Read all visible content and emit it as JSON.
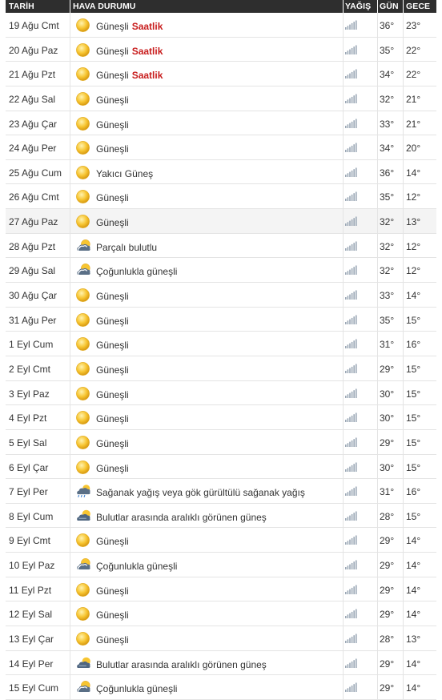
{
  "header": {
    "date": "TARİH",
    "weather": "HAVA DURUMU",
    "rain": "YAĞIŞ",
    "day": "GÜN",
    "night": "GECE"
  },
  "hourly_label": "Saatlik",
  "rows": [
    {
      "date": "19 Ağu Cmt",
      "condition": "Güneşli",
      "icon": "sun-icon",
      "hourly": true,
      "day": "36°",
      "night": "23°"
    },
    {
      "date": "20 Ağu Paz",
      "condition": "Güneşli",
      "icon": "sun-icon",
      "hourly": true,
      "day": "35°",
      "night": "22°"
    },
    {
      "date": "21 Ağu Pzt",
      "condition": "Güneşli",
      "icon": "sun-icon",
      "hourly": true,
      "day": "34°",
      "night": "22°"
    },
    {
      "date": "22 Ağu Sal",
      "condition": "Güneşli",
      "icon": "sun-icon",
      "day": "32°",
      "night": "21°"
    },
    {
      "date": "23 Ağu Çar",
      "condition": "Güneşli",
      "icon": "sun-icon",
      "day": "33°",
      "night": "21°"
    },
    {
      "date": "24 Ağu Per",
      "condition": "Güneşli",
      "icon": "sun-icon",
      "day": "34°",
      "night": "20°"
    },
    {
      "date": "25 Ağu Cum",
      "condition": "Yakıcı Güneş",
      "icon": "sun-icon",
      "day": "36°",
      "night": "14°"
    },
    {
      "date": "26 Ağu Cmt",
      "condition": "Güneşli",
      "icon": "sun-icon",
      "day": "35°",
      "night": "12°"
    },
    {
      "date": "27 Ağu Paz",
      "condition": "Güneşli",
      "icon": "sun-icon",
      "day": "32°",
      "night": "13°",
      "highlight": true
    },
    {
      "date": "28 Ağu Pzt",
      "condition": "Parçalı bulutlu",
      "icon": "partly-cloudy-icon",
      "day": "32°",
      "night": "12°"
    },
    {
      "date": "29 Ağu Sal",
      "condition": "Çoğunlukla güneşli",
      "icon": "partly-cloudy-icon",
      "day": "32°",
      "night": "12°"
    },
    {
      "date": "30 Ağu Çar",
      "condition": "Güneşli",
      "icon": "sun-icon",
      "day": "33°",
      "night": "14°"
    },
    {
      "date": "31 Ağu Per",
      "condition": "Güneşli",
      "icon": "sun-icon",
      "day": "35°",
      "night": "15°"
    },
    {
      "date": "1 Eyl Cum",
      "condition": "Güneşli",
      "icon": "sun-icon",
      "day": "31°",
      "night": "16°"
    },
    {
      "date": "2 Eyl Cmt",
      "condition": "Güneşli",
      "icon": "sun-icon",
      "day": "29°",
      "night": "15°"
    },
    {
      "date": "3 Eyl Paz",
      "condition": "Güneşli",
      "icon": "sun-icon",
      "day": "30°",
      "night": "15°"
    },
    {
      "date": "4 Eyl Pzt",
      "condition": "Güneşli",
      "icon": "sun-icon",
      "day": "30°",
      "night": "15°"
    },
    {
      "date": "5 Eyl Sal",
      "condition": "Güneşli",
      "icon": "sun-icon",
      "day": "29°",
      "night": "15°"
    },
    {
      "date": "6 Eyl Çar",
      "condition": "Güneşli",
      "icon": "sun-icon",
      "day": "30°",
      "night": "15°"
    },
    {
      "date": "7 Eyl Per",
      "condition": "Sağanak yağış veya gök gürültülü sağanak yağış",
      "icon": "thunder-shower-icon",
      "day": "31°",
      "night": "16°"
    },
    {
      "date": "8 Eyl Cum",
      "condition": "Bulutlar arasında aralıklı görünen güneş",
      "icon": "cloud-sun-icon",
      "day": "28°",
      "night": "15°"
    },
    {
      "date": "9 Eyl Cmt",
      "condition": "Güneşli",
      "icon": "sun-icon",
      "day": "29°",
      "night": "14°"
    },
    {
      "date": "10 Eyl Paz",
      "condition": "Çoğunlukla güneşli",
      "icon": "partly-cloudy-icon",
      "day": "29°",
      "night": "14°"
    },
    {
      "date": "11 Eyl Pzt",
      "condition": "Güneşli",
      "icon": "sun-icon",
      "day": "29°",
      "night": "14°"
    },
    {
      "date": "12 Eyl Sal",
      "condition": "Güneşli",
      "icon": "sun-icon",
      "day": "29°",
      "night": "14°"
    },
    {
      "date": "13 Eyl Çar",
      "condition": "Güneşli",
      "icon": "sun-icon",
      "day": "28°",
      "night": "13°"
    },
    {
      "date": "14 Eyl Per",
      "condition": "Bulutlar arasında aralıklı görünen güneş",
      "icon": "cloud-sun-icon",
      "day": "29°",
      "night": "14°"
    },
    {
      "date": "15 Eyl Cum",
      "condition": "Çoğunlukla güneşli",
      "icon": "partly-cloudy-icon",
      "day": "29°",
      "night": "14°"
    }
  ],
  "colors": {
    "header_bg": "#2e2e2e",
    "hourly_link": "#c81d1d",
    "highlight_row": "#f4f4f4"
  },
  "rain_icon": "signal-bars-icon"
}
